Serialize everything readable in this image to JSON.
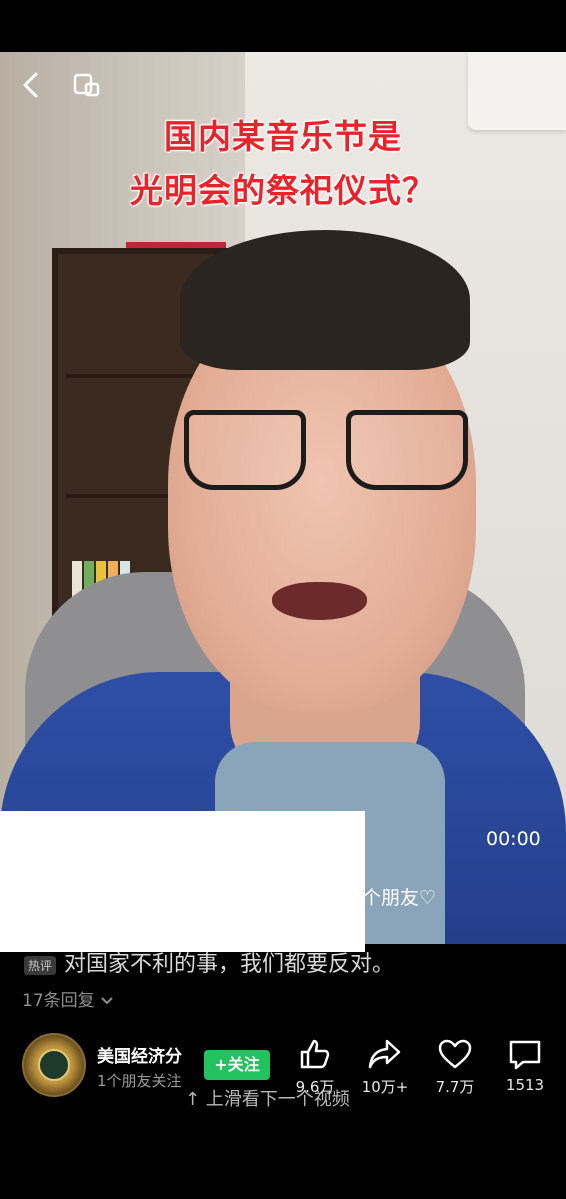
{
  "video": {
    "subtitle_line1": "国内某音乐节是",
    "subtitle_line2": "光明会的祭祀仪式？",
    "timer": "00:00",
    "friends_overlay": "个朋友♡"
  },
  "top_bar": {
    "back_icon": "chevron-left-icon",
    "pip_icon": "picture-in-picture-icon"
  },
  "comment": {
    "tag": "热评",
    "text": "对国家不利的事，我们都要反对。",
    "reply_count": "17条回复"
  },
  "author": {
    "name": "美国经济分",
    "sub": "1个朋友关注",
    "follow_label": "+关注"
  },
  "swipe_hint": "↑ 上滑看下一个视频",
  "actions": [
    {
      "icon": "thumbs-up-icon",
      "count": "9.6万"
    },
    {
      "icon": "share-icon",
      "count": "10万+"
    },
    {
      "icon": "heart-icon",
      "count": "7.7万"
    },
    {
      "icon": "comment-icon",
      "count": "1513"
    }
  ],
  "colors": {
    "subtitle": "#e8242a",
    "follow_button": "#22c35e",
    "background": "#000000"
  }
}
